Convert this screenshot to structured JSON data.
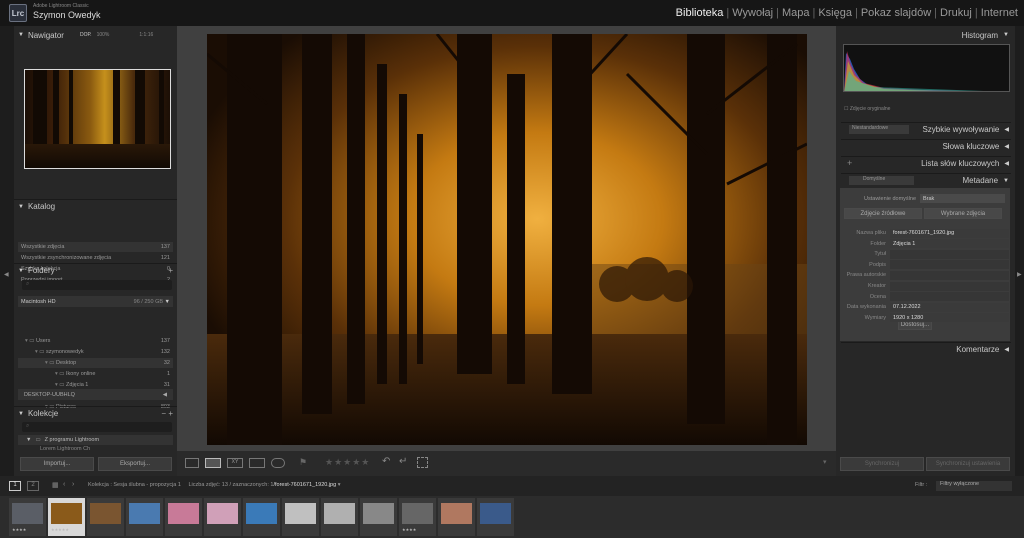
{
  "app": {
    "logo": "Lrc",
    "name": "Adobe Lightroom Classic",
    "user": "Szymon Owedyk"
  },
  "modules": [
    {
      "label": "Biblioteka",
      "active": true
    },
    {
      "label": "Wywołaj",
      "active": false
    },
    {
      "label": "Mapa",
      "active": false
    },
    {
      "label": "Księga",
      "active": false
    },
    {
      "label": "Pokaz slajdów",
      "active": false
    },
    {
      "label": "Drukuj",
      "active": false
    },
    {
      "label": "Internet",
      "active": false
    }
  ],
  "navigator": {
    "title": "Nawigator",
    "zoom": [
      "DOP.",
      "100%",
      "1:1",
      "1:1:16"
    ]
  },
  "catalog": {
    "title": "Katalog",
    "items": [
      {
        "label": "Wszystkie zdjęcia",
        "count": "137"
      },
      {
        "label": "Wszystkie zsynchronizowane zdjęcia",
        "count": "121"
      },
      {
        "label": "Szybka kolekcja",
        "count": "0"
      },
      {
        "label": "Poprzedni import",
        "count": "2"
      }
    ]
  },
  "folders": {
    "title": "Foldery",
    "volume": "Macintosh HD",
    "volume_info": "96 / 250 GB",
    "tree": [
      {
        "label": "Users",
        "count": "137",
        "indent": 0
      },
      {
        "label": "szymonowedyk",
        "count": "132",
        "indent": 1
      },
      {
        "label": "Desktop",
        "count": "32",
        "indent": 2
      },
      {
        "label": "Ikony online",
        "count": "1",
        "indent": 3
      },
      {
        "label": "Zdjęcia 1",
        "count": "31",
        "indent": 3
      },
      {
        "label": "Documents",
        "count": "2",
        "indent": 2
      },
      {
        "label": "Pictures",
        "count": "803",
        "indent": 2
      }
    ],
    "other_volume": "DESKTOP-UUBHLQ"
  },
  "collections": {
    "title": "Kolekcje",
    "items": [
      {
        "label": "Z programu Lightroom"
      },
      {
        "label": "Lorem Lightroom Ch"
      }
    ]
  },
  "buttons": {
    "import": "Importuj...",
    "export": "Eksportuj...",
    "sync_meta": "Synchronizuj",
    "sync_settings": "Synchronizuj ustawienia"
  },
  "right": {
    "histogram": "Histogram",
    "original": "Zdjęcie oryginalne",
    "quick_develop": "Szybkie wywoływanie",
    "qd_preset": "Niestandardowe",
    "keywords": "Słowa kluczowe",
    "keyword_list": "Lista słów kluczowych",
    "metadata": "Metadane",
    "meta_preset": "Domyślne",
    "default_label": "Ustawienie domyślne",
    "default_value": "Brak",
    "tab1": "Zdjęcie źródłowe",
    "tab2": "Wybrane zdjęcia",
    "fields": [
      {
        "k": "Nazwa pliku",
        "v": "forest-7601671_1920.jpg"
      },
      {
        "k": "Folder",
        "v": "Zdjęcia 1"
      },
      {
        "k": "Tytuł",
        "v": ""
      },
      {
        "k": "Podpis",
        "v": ""
      },
      {
        "k": "Prawa autorskie",
        "v": ""
      },
      {
        "k": "Kreator",
        "v": ""
      },
      {
        "k": "Ocena",
        "v": ""
      },
      {
        "k": "Data wykonania",
        "v": "07.12.2022"
      },
      {
        "k": "Wymiary",
        "v": "1920 x 1280"
      }
    ],
    "customize": "Dostosuj...",
    "comments": "Komentarze"
  },
  "filmbar": {
    "pages": [
      "1",
      "2"
    ],
    "path_prefix": "Kolekcja : Sesja ślubna - propozycja 1",
    "count": "Liczba zdjęć: 13 / zaznaczonych: 1",
    "filename": "/forest-7601671_1920.jpg",
    "filter_label": "Filtr :",
    "filter_value": "Filtry wyłączone"
  },
  "filmstrip": [
    {
      "bg": "#5a5e66",
      "stars": "★★★★"
    },
    {
      "bg": "#8a5a1a",
      "stars": "★★★★★"
    },
    {
      "bg": "#7a5530",
      "stars": ""
    },
    {
      "bg": "#4a7ab0",
      "stars": ""
    },
    {
      "bg": "#c87a98",
      "stars": ""
    },
    {
      "bg": "#d0a0b8",
      "stars": ""
    },
    {
      "bg": "#3a7ab8",
      "stars": ""
    },
    {
      "bg": "#c0c0c0",
      "stars": ""
    },
    {
      "bg": "#b0b0b0",
      "stars": ""
    },
    {
      "bg": "#888888",
      "stars": ""
    },
    {
      "bg": "#666666",
      "stars": "★★★★"
    },
    {
      "bg": "#b07860",
      "stars": ""
    },
    {
      "bg": "#3a5a8a",
      "stars": ""
    }
  ]
}
